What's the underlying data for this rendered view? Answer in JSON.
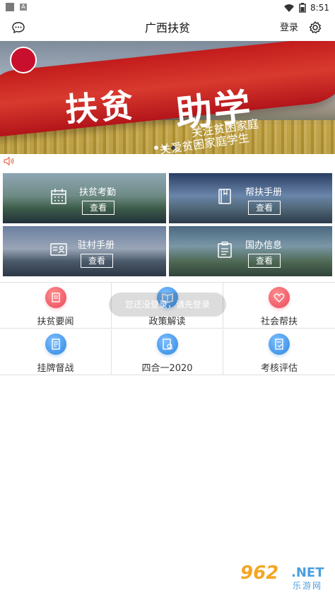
{
  "status_bar": {
    "time": "8:51",
    "badge_letter": "A"
  },
  "header": {
    "title": "广西扶贫",
    "login_label": "登录"
  },
  "banner": {
    "slogan_main_1": "扶贫",
    "slogan_main_2": "助学",
    "slogan_sub_1": "关注贫困家庭",
    "slogan_sub_2": "关爱贫困家庭学生",
    "dots_count": 3,
    "active_dot": 3
  },
  "cards": [
    {
      "title": "扶贫考勤",
      "button": "查看",
      "icon": "calendar-icon"
    },
    {
      "title": "帮扶手册",
      "button": "查看",
      "icon": "book-icon"
    },
    {
      "title": "驻村手册",
      "button": "查看",
      "icon": "id-card-icon"
    },
    {
      "title": "国办信息",
      "button": "查看",
      "icon": "clipboard-icon"
    }
  ],
  "grid": [
    {
      "label": "扶贫要闻",
      "icon": "news-icon",
      "color": "#e8475a"
    },
    {
      "label": "政策解读",
      "icon": "open-book-icon",
      "color": "#2f86e0"
    },
    {
      "label": "社会帮扶",
      "icon": "heart-hands-icon",
      "color": "#e8475a"
    },
    {
      "label": "挂牌督战",
      "icon": "document-icon",
      "color": "#2f86e0"
    },
    {
      "label": "四合一2020",
      "icon": "doc-search-icon",
      "color": "#2f86e0"
    },
    {
      "label": "考核评估",
      "icon": "report-icon",
      "color": "#2f86e0"
    }
  ],
  "toast": {
    "text": "您还没登录，请先登录"
  },
  "watermark": {
    "number": "962",
    "net": ".NET",
    "site": "乐游网"
  }
}
